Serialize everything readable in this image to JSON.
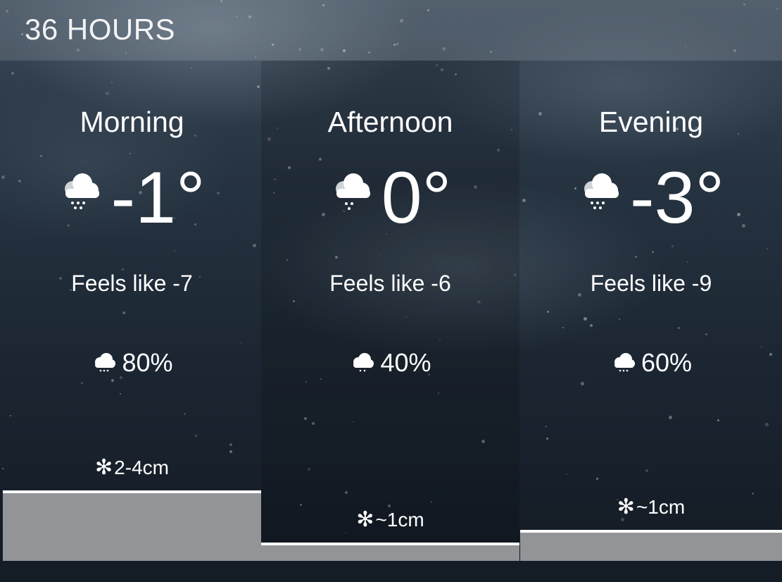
{
  "header": {
    "title": "36 HOURS"
  },
  "periods": [
    {
      "name": "Morning",
      "temp": "-1°",
      "feels_like": "Feels like -7",
      "precip_chance": "80%",
      "snow_accumulation": "2-4cm",
      "accumulation_level": 0.75,
      "condition_icon": "cloud-snow-icon"
    },
    {
      "name": "Afternoon",
      "temp": "0°",
      "feels_like": "Feels like -6",
      "precip_chance": "40%",
      "snow_accumulation": "~1cm",
      "accumulation_level": 0.15,
      "condition_icon": "cloud-snow-icon"
    },
    {
      "name": "Evening",
      "temp": "-3°",
      "feels_like": "Feels like -9",
      "precip_chance": "60%",
      "snow_accumulation": "~1cm",
      "accumulation_level": 0.3,
      "condition_icon": "cloud-snow-icon"
    }
  ],
  "colors": {
    "accumulation_bar": "#929497",
    "bar_top_line": "#ffffff"
  }
}
